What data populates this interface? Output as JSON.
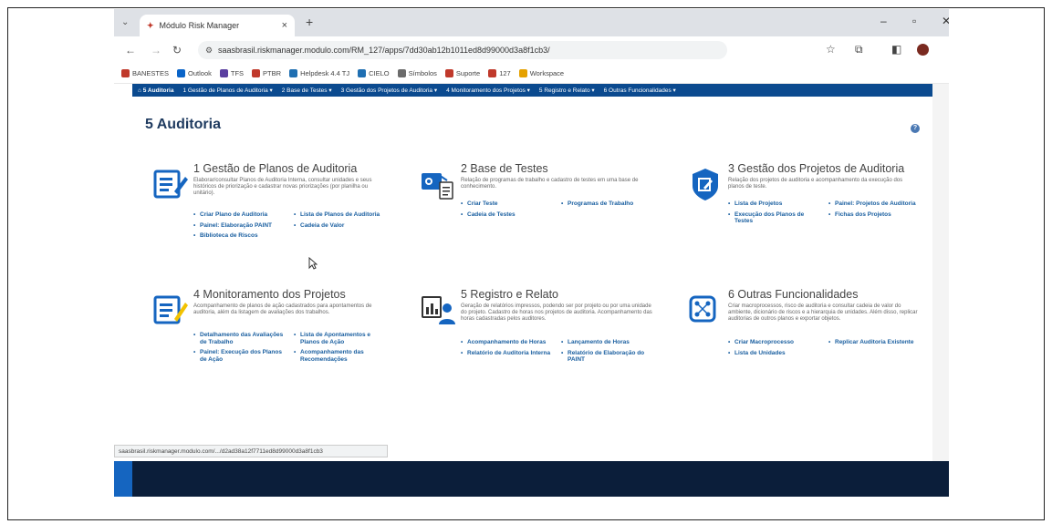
{
  "browser": {
    "tab_title": "Módulo Risk Manager",
    "tab_close": "×",
    "new_tab": "+",
    "url": "saasbrasil.riskmanager.modulo.com/RM_127/apps/7dd30ab12b1011ed8d99000d3a8f1cb3/",
    "status_url": "saasbrasil.riskmanager.modulo.com/.../d2ad38a12f7711ed8d99000d3a8f1cb3"
  },
  "bookmarks": [
    {
      "label": "BANESTES",
      "color": "#c0392b"
    },
    {
      "label": "Outlook",
      "color": "#0a64c8"
    },
    {
      "label": "TFS",
      "color": "#5a3fa0"
    },
    {
      "label": "PTBR",
      "color": "#c0392b"
    },
    {
      "label": "Helpdesk 4.4 TJ",
      "color": "#1f6fb2"
    },
    {
      "label": "CIELO",
      "color": "#1f6fb2"
    },
    {
      "label": "Símbolos",
      "color": "#6b6b6b"
    },
    {
      "label": "Suporte",
      "color": "#c0392b"
    },
    {
      "label": "127",
      "color": "#c0392b"
    },
    {
      "label": "Workspace",
      "color": "#e5a100"
    }
  ],
  "menu": {
    "home": "5 Auditoria",
    "items": [
      "1 Gestão de Planos de Auditoria",
      "2 Base de Testes",
      "3 Gestão dos Projetos de Auditoria",
      "4 Monitoramento dos Projetos",
      "5 Registro e Relato",
      "6 Outras Funcionalidades"
    ]
  },
  "page": {
    "title": "5 Auditoria",
    "help": "?"
  },
  "cards": [
    {
      "title": "1 Gestão de Planos de Auditoria",
      "desc": "Elaborar/consultar Planos de Auditoria Interna, consultar unidades e seus históricos de priorização e cadastrar novas priorizações (por planilha ou unitário).",
      "links": [
        "Criar Plano de Auditoria",
        "Lista de Planos de Auditoria",
        "Painel: Elaboração PAINT",
        "Cadeia de Valor",
        "Biblioteca de Riscos"
      ]
    },
    {
      "title": "2 Base de Testes",
      "desc": "Relação de programas de trabalho e cadastro de testes em uma base de conhecimento.",
      "links": [
        "Criar Teste",
        "Programas de Trabalho",
        "Cadeia de Testes"
      ]
    },
    {
      "title": "3 Gestão dos Projetos de Auditoria",
      "desc": "Relação dos projetos de auditoria e acompanhamento da execução dos planos de teste.",
      "links": [
        "Lista de Projetos",
        "Painel: Projetos de Auditoria",
        "Execução dos Planos de Testes",
        "Fichas dos Projetos"
      ]
    },
    {
      "title": "4 Monitoramento dos Projetos",
      "desc": "Acompanhamento de planos de ação cadastrados para apontamentos de auditoria, além da listagem de avaliações dos trabalhos.",
      "links": [
        "Detalhamento das Avaliações de Trabalho",
        "Lista de Apontamentos e Planos de Ação",
        "Painel: Execução dos Planos de Ação",
        "Acompanhamento das Recomendações"
      ]
    },
    {
      "title": "5 Registro e Relato",
      "desc": "Geração de relatórios impressos, podendo ser por projeto ou por uma unidade do projeto. Cadastro de horas nos projetos de auditoria. Acompanhamento das horas cadastradas pelos auditores.",
      "links": [
        "Acompanhamento de Horas",
        "Lançamento de Horas",
        "Relatório de Auditoria Interna",
        "Relatório de Elaboração do PAINT"
      ]
    },
    {
      "title": "6 Outras Funcionalidades",
      "desc": "Criar macroprocessos, risco de auditoria e consultar cadeia de valor do ambiente, dicionário de riscos e a hierarquia de unidades. Além disso, replicar auditorias de outros planos e exportar objetos.",
      "links": [
        "Criar Macroprocesso",
        "Replicar Auditoria Existente",
        "Lista de Unidades"
      ]
    }
  ],
  "colors": {
    "menu_bar": "#0b4a8f",
    "link": "#1a5fa0",
    "icon": "#1565c0",
    "title": "#1e3a5f"
  }
}
